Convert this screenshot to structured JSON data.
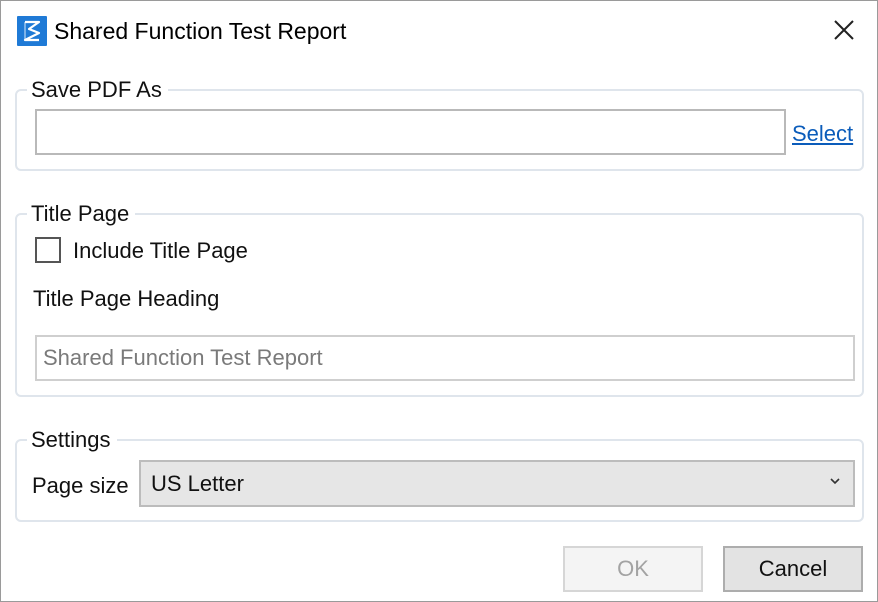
{
  "window": {
    "title": "Shared Function Test Report"
  },
  "save_pdf": {
    "legend": "Save PDF As",
    "path_value": "",
    "select_link": "Select"
  },
  "title_page": {
    "legend": "Title Page",
    "include_label": "Include Title Page",
    "include_checked": false,
    "heading_label": "Title Page Heading",
    "heading_value": "Shared Function Test Report"
  },
  "settings": {
    "legend": "Settings",
    "page_size_label": "Page size",
    "page_size_value": "US Letter"
  },
  "buttons": {
    "ok": "OK",
    "cancel": "Cancel"
  },
  "icons": {
    "app": "app-logo-icon",
    "close": "close-icon",
    "dropdown": "chevron-down-icon"
  },
  "colors": {
    "accent": "#1f7ad6",
    "link": "#0b5cba"
  }
}
